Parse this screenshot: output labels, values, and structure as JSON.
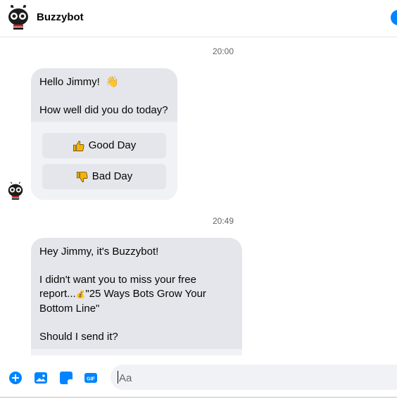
{
  "header": {
    "title": "Buzzybot"
  },
  "messages": [
    {
      "timestamp": "20:00",
      "greeting": "Hello Jimmy!",
      "greeting_emoji": "👋",
      "question": "How well did you do today?",
      "buttons": [
        {
          "label": "Good Day",
          "icon": "thumbs-up-icon"
        },
        {
          "label": "Bad Day",
          "icon": "thumbs-down-icon"
        }
      ]
    },
    {
      "timestamp": "20:49",
      "line1": "Hey Jimmy, it's Buzzybot!",
      "line2a": "I didn't want you to miss your free",
      "line2b": "report...",
      "line2_emoji": "💰",
      "line2c": "\"25 Ways Bots Grow Your",
      "line2d": "Bottom Line\"",
      "line3": "Should I send it?"
    }
  ],
  "composer": {
    "placeholder": "Aa"
  },
  "footer_icons": [
    "add-icon",
    "photo-icon",
    "sticker-icon",
    "gif-icon"
  ],
  "colors": {
    "accent": "#0084ff",
    "bubble": "#e4e6eb",
    "button_area": "#f0f2f5"
  }
}
